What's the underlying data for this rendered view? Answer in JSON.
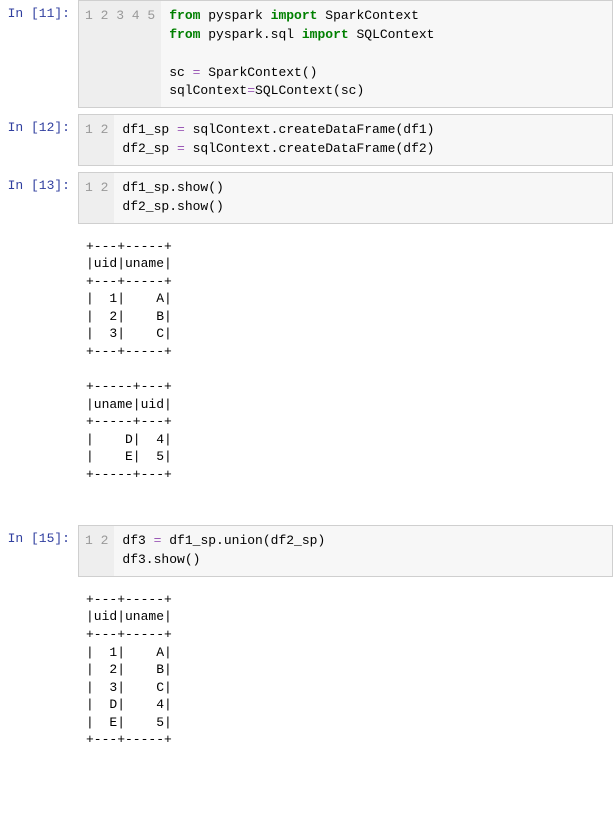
{
  "cells": {
    "c11": {
      "prompt": "In [11]:",
      "gutter": "1\n2\n3\n4\n5",
      "tokens": [
        {
          "t": "from",
          "c": "kw"
        },
        {
          "t": " pyspark "
        },
        {
          "t": "import",
          "c": "kw"
        },
        {
          "t": " SparkContext\n"
        },
        {
          "t": "from",
          "c": "kw"
        },
        {
          "t": " pyspark.sql "
        },
        {
          "t": "import",
          "c": "kw"
        },
        {
          "t": " SQLContext\n"
        },
        {
          "t": "\n"
        },
        {
          "t": "sc "
        },
        {
          "t": "=",
          "c": "op"
        },
        {
          "t": " SparkContext()\n"
        },
        {
          "t": "sqlContext"
        },
        {
          "t": "=",
          "c": "op"
        },
        {
          "t": "SQLContext(sc)"
        }
      ]
    },
    "c12": {
      "prompt": "In [12]:",
      "gutter": "1\n2",
      "tokens": [
        {
          "t": "df1_sp "
        },
        {
          "t": "=",
          "c": "op"
        },
        {
          "t": " sqlContext.createDataFrame(df1)\n"
        },
        {
          "t": "df2_sp "
        },
        {
          "t": "=",
          "c": "op"
        },
        {
          "t": " sqlContext.createDataFrame(df2)"
        }
      ]
    },
    "c13": {
      "prompt": "In  [13]:",
      "gutter": "1\n2",
      "tokens": [
        {
          "t": "df1_sp.show()\n"
        },
        {
          "t": "df2_sp.show()"
        }
      ]
    },
    "o13": "+---+-----+\n|uid|uname|\n+---+-----+\n|  1|    A|\n|  2|    B|\n|  3|    C|\n+---+-----+\n\n+-----+---+\n|uname|uid|\n+-----+---+\n|    D|  4|\n|    E|  5|\n+-----+---+\n",
    "c15": {
      "prompt": "In [15]:",
      "gutter": "1\n2",
      "tokens": [
        {
          "t": "df3 "
        },
        {
          "t": "=",
          "c": "op"
        },
        {
          "t": " df1_sp.union(df2_sp)\n"
        },
        {
          "t": "df3.show()"
        }
      ]
    },
    "o15": "+---+-----+\n|uid|uname|\n+---+-----+\n|  1|    A|\n|  2|    B|\n|  3|    C|\n|  D|    4|\n|  E|    5|\n+---+-----+\n"
  }
}
